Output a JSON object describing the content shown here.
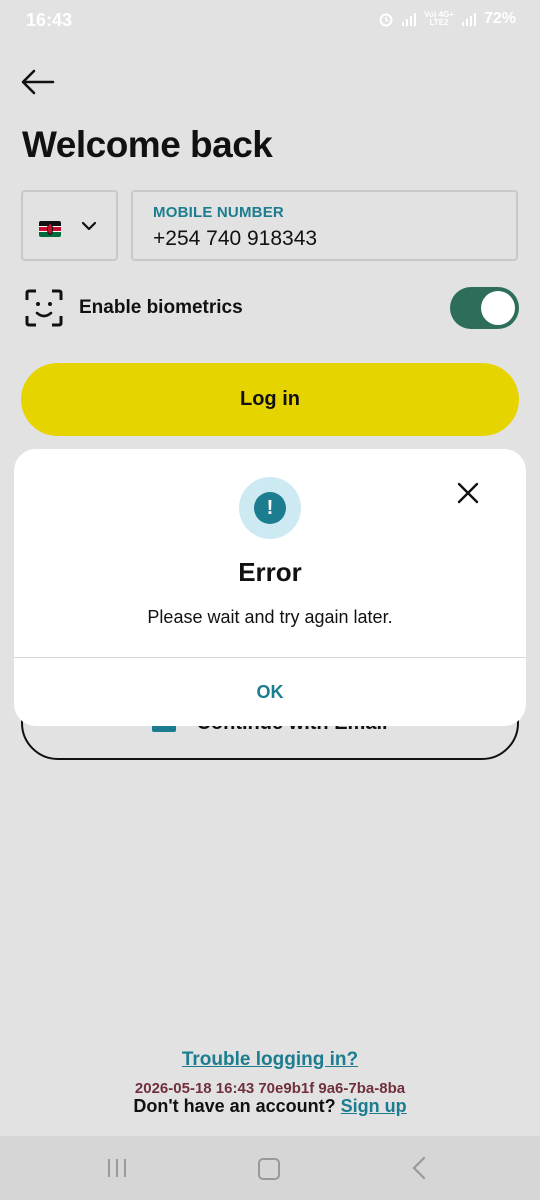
{
  "status_bar": {
    "time": "16:43",
    "net_top": "Vo) 4G+",
    "net_bottom": "LTE2",
    "battery": "72%"
  },
  "page": {
    "title": "Welcome back"
  },
  "phone": {
    "country_flag": "kenya-flag",
    "label": "MOBILE NUMBER",
    "value": "+254 740 918343"
  },
  "biometrics": {
    "label": "Enable biometrics",
    "enabled": true
  },
  "buttons": {
    "login": "Log in",
    "email": "Continue with Email"
  },
  "dialog": {
    "title": "Error",
    "message": "Please wait and try again later.",
    "ok": "OK"
  },
  "footer": {
    "trouble": "Trouble logging in?",
    "no_account": "Don't have an account?",
    "signup": "Sign up"
  },
  "watermark": "2026-05-18 16:43 70e9b1f 9a6-7ba-8ba",
  "colors": {
    "accent_teal": "#1b7d8f",
    "login_yellow": "#e6d400",
    "toggle_green": "#2e6d5b",
    "background": "#e2e2e2"
  }
}
